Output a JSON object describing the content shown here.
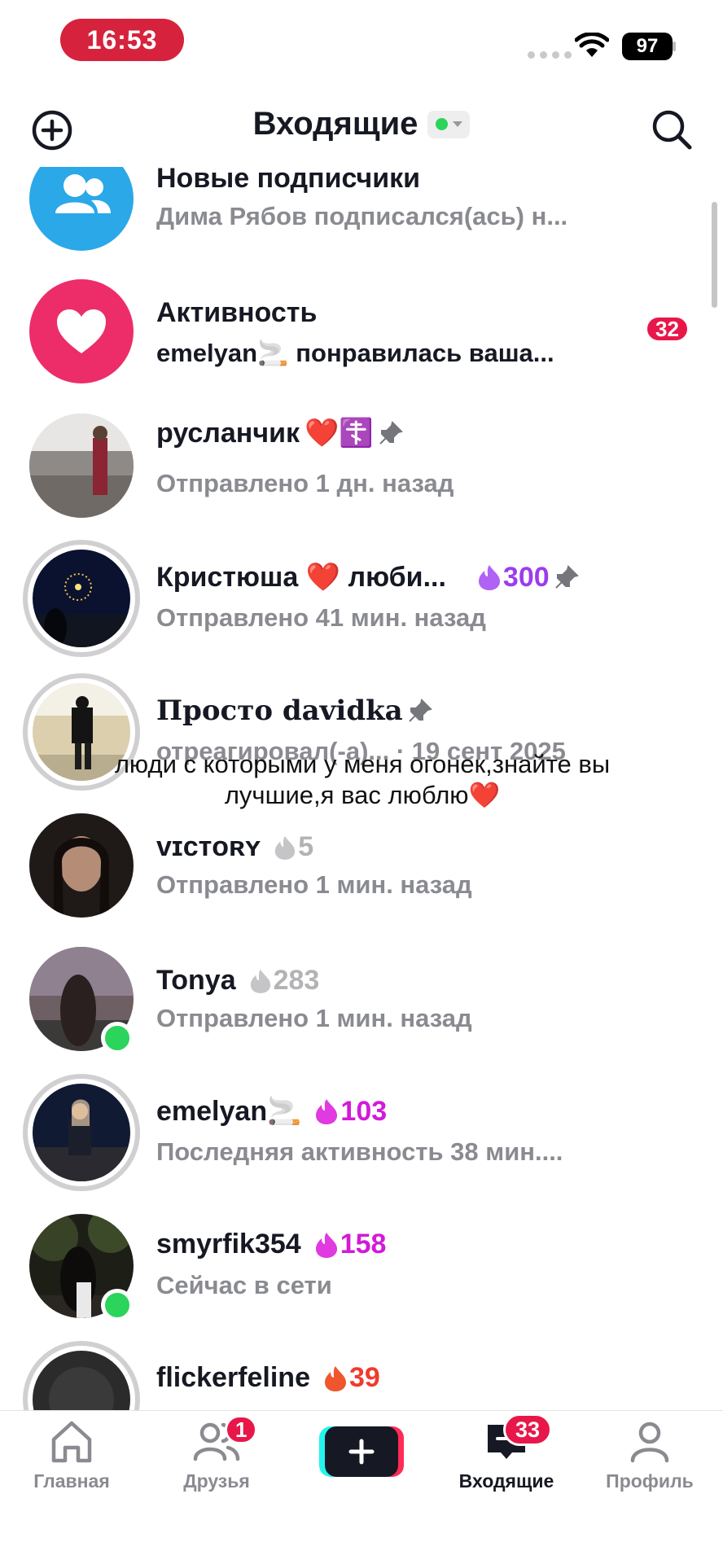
{
  "status_bar": {
    "time": "16:53",
    "battery": "97"
  },
  "header": {
    "title": "Входящие"
  },
  "system_rows": {
    "followers": {
      "title": "Новые подписчики",
      "subtitle": "Дима Рябов подписался(ась) н..."
    },
    "activity": {
      "title": "Активность",
      "subtitle": "emelyan🚬 понравилась ваша...",
      "badge": "32"
    }
  },
  "chats": [
    {
      "name": "русланчик",
      "emoji": "❤️☦️",
      "streak": "",
      "subtitle": "Отправлено 1 дн. назад"
    },
    {
      "name": "Кристюша ❤️ люби...",
      "emoji": "",
      "streak": "300",
      "subtitle": "Отправлено 41 мин. назад"
    },
    {
      "name": "Просто 𝐝𝐚𝐯𝐢𝐝𝐤𝐚",
      "emoji": "",
      "streak": "",
      "subtitle": "отреагировал(-а)...  · 19 сент 2025"
    },
    {
      "name": "ᴠɪᴄᴛᴏʀʏ",
      "emoji": "",
      "streak": "5",
      "subtitle": "Отправлено 1 мин. назад"
    },
    {
      "name": "Tonya",
      "emoji": "",
      "streak": "283",
      "subtitle": "Отправлено 1 мин. назад"
    },
    {
      "name": "emelyan🚬",
      "emoji": "",
      "streak": "103",
      "subtitle": "Последняя активность 38 мин...."
    },
    {
      "name": "smyrfik354",
      "emoji": "",
      "streak": "158",
      "subtitle": "Сейчас в сети"
    },
    {
      "name": "flickerfeline",
      "emoji": "",
      "streak": "39",
      "subtitle": ""
    }
  ],
  "overlay_text": "люди с которыми у меня огонек,знайте вы лучшие,я вас люблю❤️",
  "tabs": {
    "home": "Главная",
    "friends": "Друзья",
    "friends_badge": "1",
    "inbox": "Входящие",
    "inbox_badge": "33",
    "profile": "Профиль"
  },
  "colors": {
    "accent_red": "#e8174a",
    "follower_icon_bg": "#2aa8e8",
    "activity_icon_bg": "#ec2d6a",
    "streak_purple": "#9b3cf0",
    "streak_magenta": "#d21ad8",
    "streak_grey": "#b3b3b6",
    "streak_red": "#ef3b2d",
    "online_green": "#2bd45a"
  },
  "icons": [
    "add-icon",
    "search-icon",
    "followers-icon",
    "heart-icon",
    "pin-icon",
    "flame-icon",
    "home-icon",
    "friends-icon",
    "create-icon",
    "inbox-icon",
    "profile-icon",
    "wifi-icon"
  ]
}
